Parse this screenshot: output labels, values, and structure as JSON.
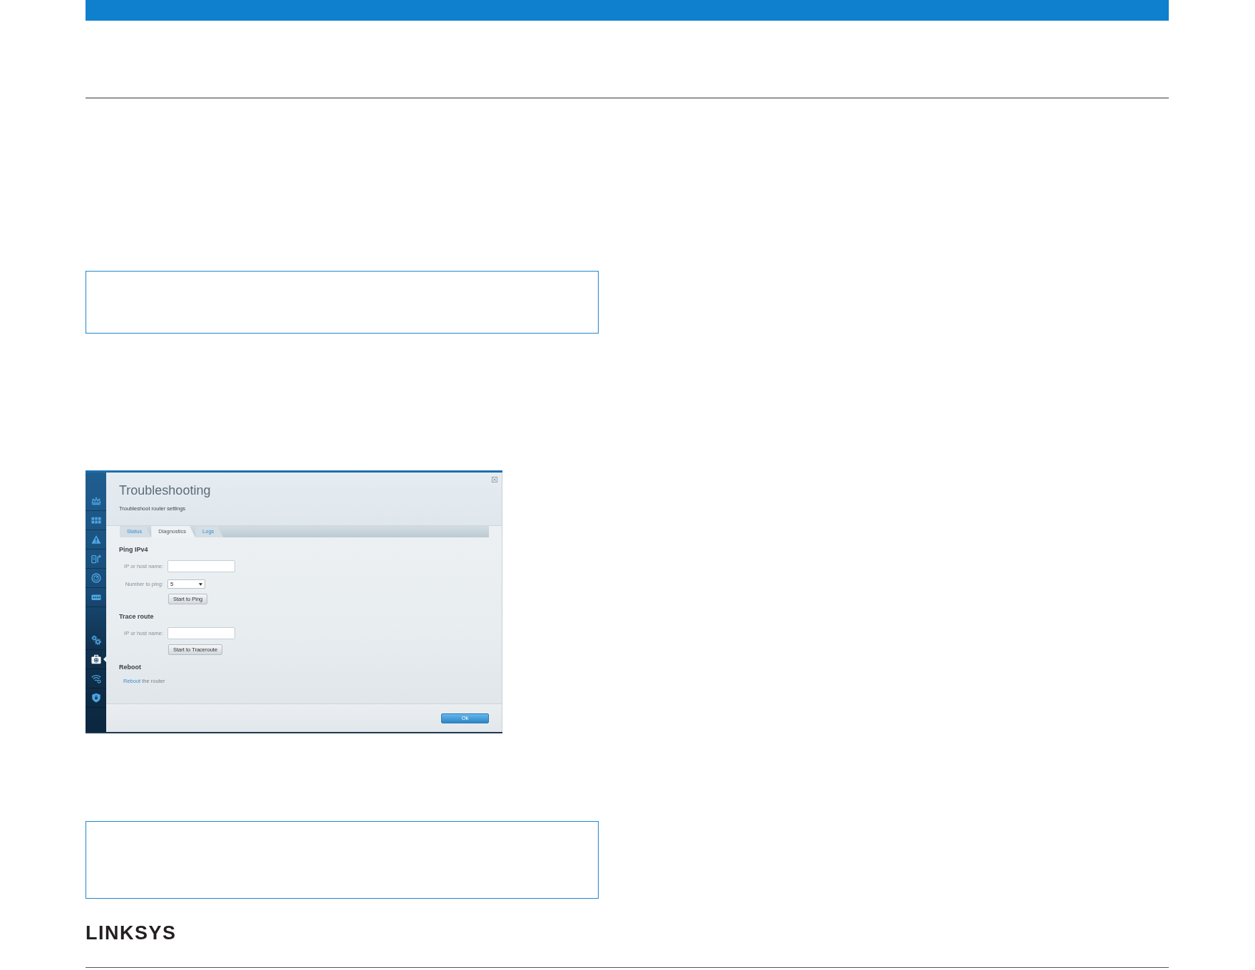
{
  "content": [
    {
      "kind": "note"
    },
    {
      "kind": "screenshot",
      "app": {
        "sidebar": {
          "groups": [
            {
              "items": [
                {
                  "selected": false
                },
                {
                  "selected": false
                },
                {
                  "selected": false
                },
                {
                  "selected": false
                },
                {
                  "selected": false
                },
                {
                  "selected": false
                }
              ]
            },
            {
              "items": [
                {
                  "selected": false
                },
                {
                  "selected": true
                },
                {
                  "selected": false
                },
                {
                  "selected": false
                }
              ]
            }
          ]
        },
        "dialog": {
          "title": "Troubleshooting",
          "subtitle": "Troubleshoot router settings",
          "tabs": [
            {
              "label": "Status",
              "selected": false
            },
            {
              "label": "Diagnostics",
              "selected": true
            },
            {
              "label": "Logs",
              "selected": false
            }
          ],
          "sections": [
            {
              "heading": "Ping IPv4",
              "fields": [
                {
                  "kind": "text",
                  "label": "IP or host name:"
                },
                {
                  "kind": "select",
                  "label": "Number to ping:",
                  "value": "5"
                }
              ],
              "button": "Start to Ping"
            },
            {
              "heading": "Trace route",
              "fields": [
                {
                  "kind": "text",
                  "label": "IP or host name:"
                }
              ],
              "button": "Start to Traceroute"
            },
            {
              "heading": "Reboot",
              "link": "Reboot",
              "text": "the router"
            }
          ],
          "footer_button": "Ok"
        }
      }
    },
    {
      "kind": "note"
    }
  ],
  "footer": {
    "logo": "LINKSYS"
  }
}
